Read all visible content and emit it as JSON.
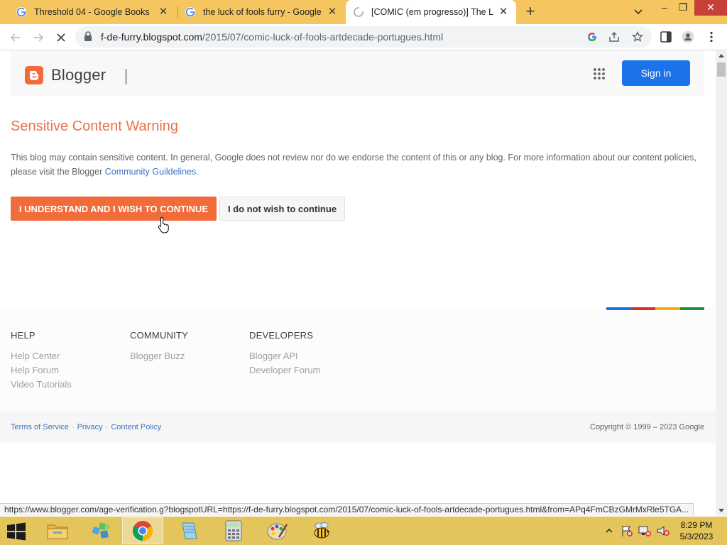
{
  "browser": {
    "tabs": [
      {
        "title": "Threshold 04 - Google Books",
        "icon": "google-icon",
        "active": false
      },
      {
        "title": "the luck of fools furry - Google S",
        "icon": "google-icon",
        "active": false
      },
      {
        "title": "[COMIC (em progresso)] The Luck",
        "icon": "loading-spinner-icon",
        "active": true
      }
    ],
    "url_host": "f-de-furry.blogspot.com",
    "url_path": "/2015/07/comic-luck-of-fools-artdecade-portugues.html",
    "status_url": "https://www.blogger.com/age-verification.g?blogspotURL=https://f-de-furry.blogspot.com/2015/07/comic-luck-of-fools-artdecade-portugues.html&from=APq4FmCBzGMrMxRle5TGA..."
  },
  "page": {
    "brand": "Blogger",
    "sign_in_label": "Sign in",
    "warning_title": "Sensitive Content Warning",
    "warning_text": "This blog may contain sensitive content. In general, Google does not review nor do we endorse the content of this or any blog. For more information about our content policies, please visit the Blogger ",
    "warning_link": "Community Guildelines",
    "warning_text_end": ".",
    "continue_label": "I UNDERSTAND AND I WISH TO CONTINUE",
    "decline_label": "I do not wish to continue",
    "accent_color": "#f26b3a",
    "signin_color": "#1a73e8"
  },
  "footer": {
    "columns": [
      {
        "heading": "HELP",
        "links": [
          "Help Center",
          "Help Forum",
          "Video Tutorials"
        ]
      },
      {
        "heading": "COMMUNITY",
        "links": [
          "Blogger Buzz"
        ]
      },
      {
        "heading": "DEVELOPERS",
        "links": [
          "Blogger API",
          "Developer Forum"
        ]
      }
    ],
    "legal_links": [
      "Terms of Service",
      "Privacy",
      "Content Policy"
    ],
    "copyright": "Copyright © 1999 – 2023 Google",
    "bar_colors": [
      "#1a73e8",
      "#d93025",
      "#f9ab00",
      "#1e8e3e"
    ]
  },
  "taskbar": {
    "apps": [
      "file-explorer-icon",
      "puzzle-app-icon",
      "chrome-icon",
      "notepad-icon",
      "calculator-icon",
      "paint-icon",
      "bee-app-icon"
    ],
    "time": "8:29 PM",
    "date": "5/3/2023"
  }
}
